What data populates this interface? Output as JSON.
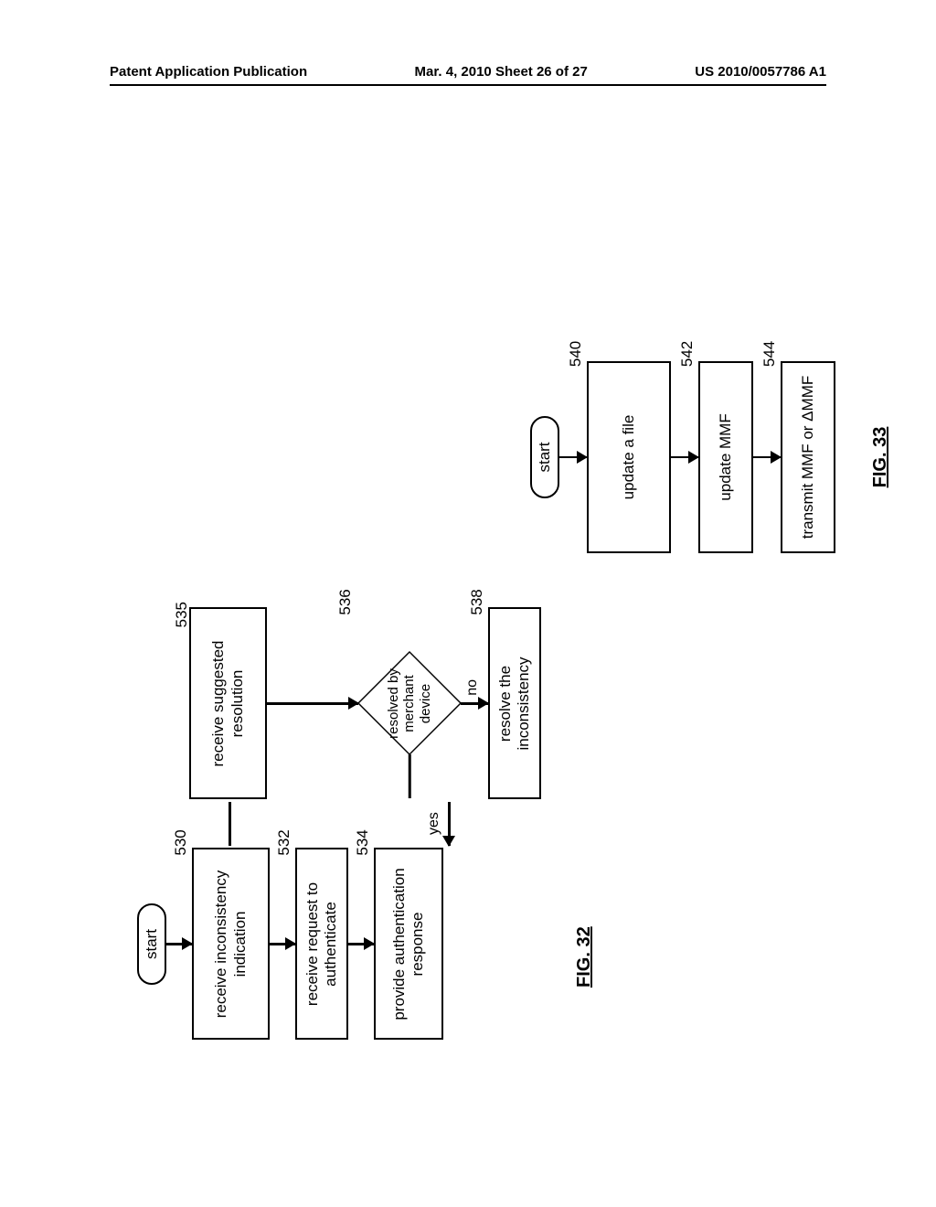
{
  "header": {
    "left": "Patent Application Publication",
    "center": "Mar. 4, 2010  Sheet 26 of 27",
    "right": "US 2010/0057786 A1"
  },
  "fig32": {
    "label": "FIG. 32",
    "start": "start",
    "steps": {
      "s530": {
        "num": "530",
        "text": "receive inconsistency indication"
      },
      "s532": {
        "num": "532",
        "text": "receive request to authenticate"
      },
      "s534": {
        "num": "534",
        "text": "provide authentication response"
      },
      "s535": {
        "num": "535",
        "text": "receive suggested resolution"
      },
      "s536": {
        "num": "536",
        "text": "resolved by merchant device"
      },
      "s538": {
        "num": "538",
        "text": "resolve the inconsistency"
      }
    },
    "edges": {
      "yes": "yes",
      "no": "no"
    }
  },
  "fig33": {
    "label": "FIG. 33",
    "start": "start",
    "steps": {
      "s540": {
        "num": "540",
        "text": "update a file"
      },
      "s542": {
        "num": "542",
        "text": "update MMF"
      },
      "s544": {
        "num": "544",
        "text": "transmit MMF or ΔMMF"
      }
    }
  }
}
